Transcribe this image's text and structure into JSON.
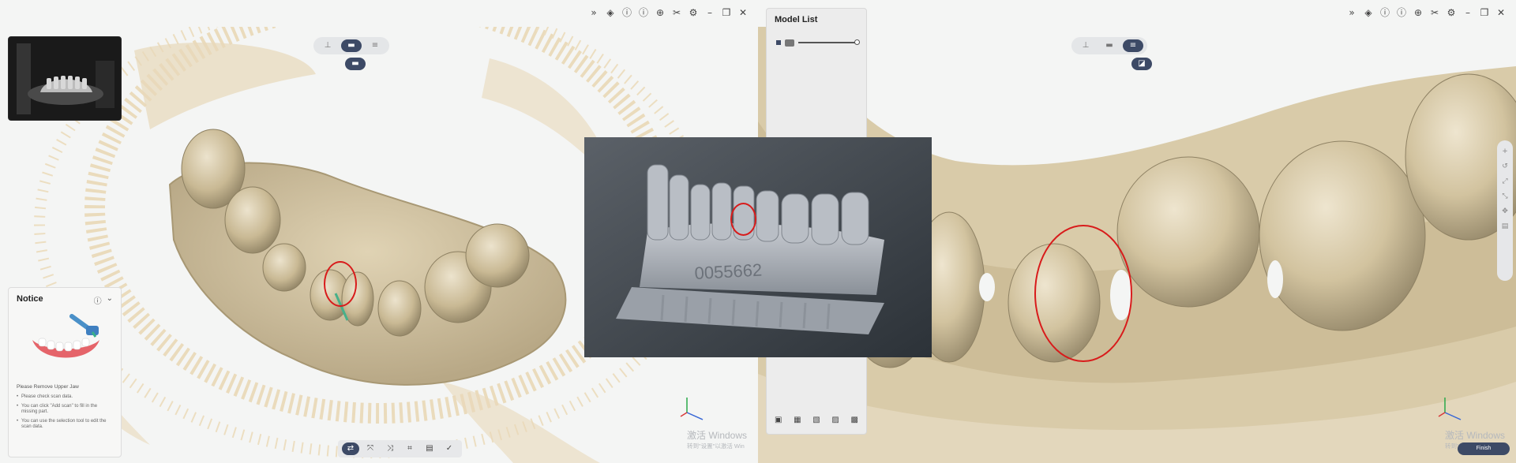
{
  "left": {
    "topbar_icons": [
      "expand-icon",
      "pin-icon",
      "info-icon",
      "help-icon",
      "target-icon",
      "tools-icon",
      "settings-icon",
      "minimize-icon",
      "restore-icon",
      "close-icon"
    ],
    "topbar_glyphs": [
      "»",
      "◈",
      "ⓘ",
      "ⓘ",
      "⊕",
      "✂",
      "⚙",
      "–",
      "❐",
      "✕"
    ],
    "view_buttons": [
      "⊥",
      "▬",
      "≡"
    ],
    "sub_button": "▬",
    "notice": {
      "title": "Notice",
      "message": "Please Remove Upper Jaw",
      "tips": [
        "Please check scan data.",
        "You can click \"Add scan\" to fill in the missing part.",
        "You can use the selection tool to edit the scan data."
      ]
    },
    "toolbar": [
      "⇄",
      "⤧",
      "⤨",
      "⌗",
      "▤",
      "✓"
    ],
    "watermark": {
      "line1": "激活 Windows",
      "line2": "转到\"设置\"以激活 Win"
    }
  },
  "right": {
    "topbar_glyphs": [
      "»",
      "◈",
      "ⓘ",
      "ⓘ",
      "⊕",
      "✂",
      "⚙",
      "–",
      "❐",
      "✕"
    ],
    "view_buttons": [
      "⊥",
      "▬",
      "≡"
    ],
    "sub_button": "◪",
    "model_list": {
      "title": "Model List",
      "tools": [
        "▣",
        "▦",
        "▧",
        "▨",
        "▩"
      ]
    },
    "side_tools": [
      "+",
      "↺",
      "⤢",
      "⤡",
      "✥",
      "▤"
    ],
    "finish_label": "Finish",
    "watermark": {
      "line1": "激活 Windows",
      "line2": "转到\"设置\"以激活 Wi"
    }
  },
  "photo": {
    "model_number": "0055662"
  },
  "colors": {
    "accent": "#3d4a66",
    "model": "#d6c7a4",
    "annotation": "#d81b1b"
  }
}
